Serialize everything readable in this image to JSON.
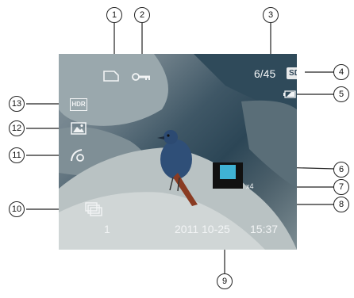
{
  "overlay": {
    "image_counter": "6/45",
    "storage_badge": "SD",
    "zoom_factor": "x4",
    "image_index": "1",
    "date": "2011 10-25",
    "time": "15:37",
    "hdr_label": "HDR"
  },
  "callouts": [
    "1",
    "2",
    "3",
    "4",
    "5",
    "6",
    "7",
    "8",
    "9",
    "10",
    "11",
    "12",
    "13"
  ],
  "icons": {
    "c1": "memory-card-icon",
    "c2": "protect-key-icon",
    "c4": "sd-card-icon",
    "c5": "battery-icon",
    "c10": "burst-group-icon",
    "c11": "rotate-icon",
    "c12": "scene-icon",
    "c13": "hdr-icon"
  }
}
